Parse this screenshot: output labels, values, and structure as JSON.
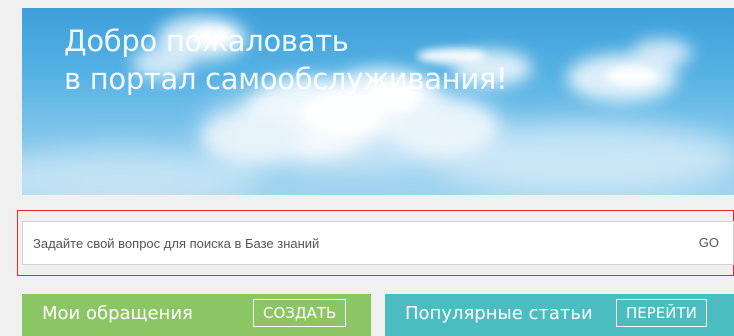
{
  "banner": {
    "title_line1": "Добро пожаловать",
    "title_line2": "в портал самообслуживания!"
  },
  "search": {
    "placeholder": "Задайте свой вопрос для поиска в Базе знаний",
    "go_label": "GO"
  },
  "panels": [
    {
      "title": "Мои обращения",
      "button_label": "СОЗДАТЬ",
      "color": "#8cc563"
    },
    {
      "title": "Популярные статьи",
      "button_label": "ПЕРЕЙТИ",
      "color": "#4bbdc1"
    }
  ],
  "colors": {
    "highlight_border": "#e0283a",
    "sky_top": "#3d9fd9",
    "sky_bottom": "#9ed2ee"
  }
}
